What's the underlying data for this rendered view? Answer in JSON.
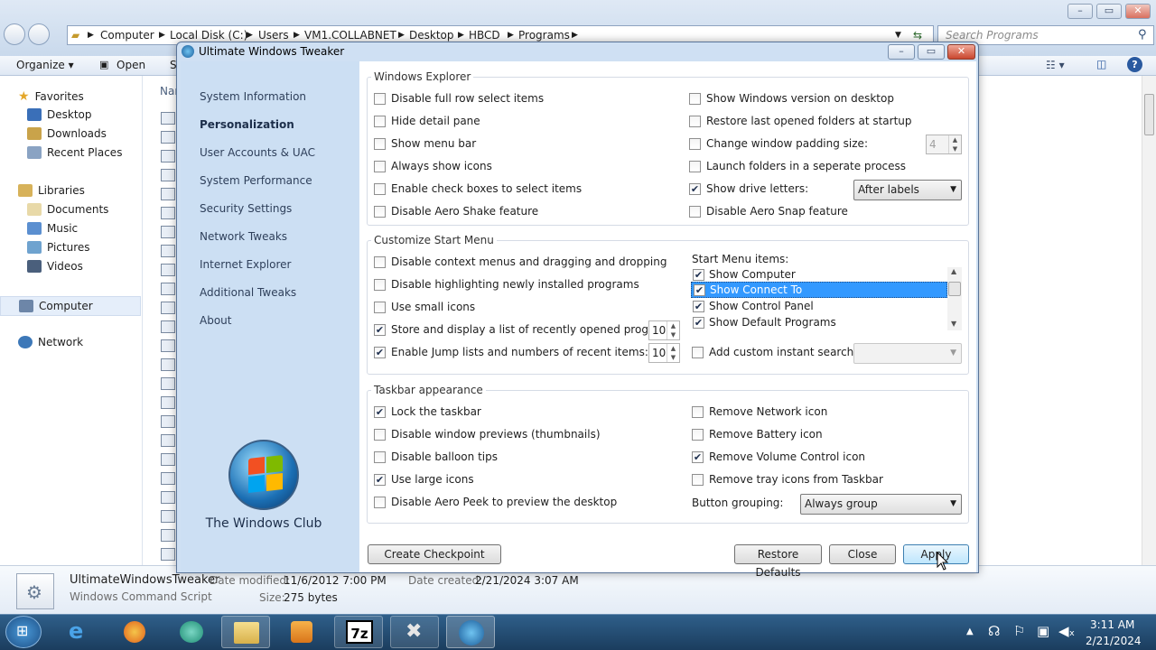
{
  "explorer": {
    "breadcrumb": [
      "Computer",
      "Local Disk (C:)",
      "Users",
      "VM1.COLLABNET",
      "Desktop",
      "HBCD",
      "Programs"
    ],
    "search_placeholder": "Search Programs",
    "toolbar": {
      "organize": "Organize",
      "open": "Open",
      "share_partial": "S"
    },
    "column_header": "Nar",
    "sidebar": {
      "favorites": "Favorites",
      "favorites_items": [
        "Desktop",
        "Downloads",
        "Recent Places"
      ],
      "libraries": "Libraries",
      "libraries_items": [
        "Documents",
        "Music",
        "Pictures",
        "Videos"
      ],
      "computer": "Computer",
      "network": "Network"
    },
    "details": {
      "name": "UltimateWindowsTweaker",
      "type": "Windows Command Script",
      "modified_label": "Date modified:",
      "modified": "11/6/2012 7:00 PM",
      "size_label": "Size:",
      "size": "275 bytes",
      "created_label": "Date created:",
      "created": "2/21/2024 3:07 AM"
    }
  },
  "dialog": {
    "title": "Ultimate Windows Tweaker",
    "nav": [
      "System Information",
      "Personalization",
      "User Accounts & UAC",
      "System Performance",
      "Security Settings",
      "Network Tweaks",
      "Internet Explorer",
      "Additional Tweaks",
      "About"
    ],
    "active_nav": "Personalization",
    "logo_text": "The Windows Club",
    "explorer_group": {
      "legend": "Windows Explorer",
      "left": [
        {
          "label": "Disable full row select items",
          "checked": false
        },
        {
          "label": "Hide detail pane",
          "checked": false
        },
        {
          "label": "Show menu bar",
          "checked": false
        },
        {
          "label": "Always show icons",
          "checked": false
        },
        {
          "label": "Enable check boxes to select items",
          "checked": false
        },
        {
          "label": "Disable Aero Shake feature",
          "checked": false
        }
      ],
      "right": [
        {
          "label": "Show Windows version on desktop",
          "checked": false
        },
        {
          "label": "Restore last opened folders at startup",
          "checked": false
        },
        {
          "label": "Change window padding size:",
          "checked": false
        },
        {
          "label": "Launch folders in a seperate process",
          "checked": false
        },
        {
          "label": "Show drive letters:",
          "checked": true
        },
        {
          "label": "Disable Aero Snap feature",
          "checked": false
        }
      ],
      "padding_value": "4",
      "drive_letters_option": "After labels"
    },
    "start_group": {
      "legend": "Customize Start Menu",
      "left": [
        {
          "label": "Disable context menus and dragging and dropping",
          "checked": false
        },
        {
          "label": "Disable highlighting newly installed programs",
          "checked": false
        },
        {
          "label": "Use small icons",
          "checked": false
        },
        {
          "label": "Store and display a list of recently opened programs:",
          "checked": true
        },
        {
          "label": "Enable Jump lists and numbers of recent items:",
          "checked": true
        }
      ],
      "recent_programs": "10",
      "jump_items": "10",
      "items_label": "Start Menu items:",
      "items": [
        {
          "label": "Show Computer",
          "checked": true,
          "selected": false
        },
        {
          "label": "Show Connect To",
          "checked": true,
          "selected": true
        },
        {
          "label": "Show Control Panel",
          "checked": true,
          "selected": false
        },
        {
          "label": "Show Default Programs",
          "checked": true,
          "selected": false
        }
      ],
      "custom_search": {
        "label": "Add custom instant search:",
        "checked": false
      }
    },
    "taskbar_group": {
      "legend": "Taskbar appearance",
      "left": [
        {
          "label": "Lock the taskbar",
          "checked": true
        },
        {
          "label": "Disable window previews (thumbnails)",
          "checked": false
        },
        {
          "label": "Disable balloon tips",
          "checked": false
        },
        {
          "label": "Use large icons",
          "checked": true
        },
        {
          "label": "Disable Aero Peek to preview the desktop",
          "checked": false
        }
      ],
      "right": [
        {
          "label": "Remove Network icon",
          "checked": false
        },
        {
          "label": "Remove Battery icon",
          "checked": false
        },
        {
          "label": "Remove Volume Control icon",
          "checked": true
        },
        {
          "label": "Remove tray icons from Taskbar",
          "checked": false
        }
      ],
      "grouping_label": "Button grouping:",
      "grouping_option": "Always group"
    },
    "buttons": {
      "checkpoint": "Create Checkpoint",
      "restore": "Restore Defaults",
      "close": "Close",
      "apply": "Apply"
    }
  },
  "tray": {
    "time": "3:11 AM",
    "date": "2/21/2024"
  },
  "colors": {
    "selection": "#3399ff",
    "dialog_frame": "#cfe0f3",
    "taskbar": "#1b3d5e"
  }
}
